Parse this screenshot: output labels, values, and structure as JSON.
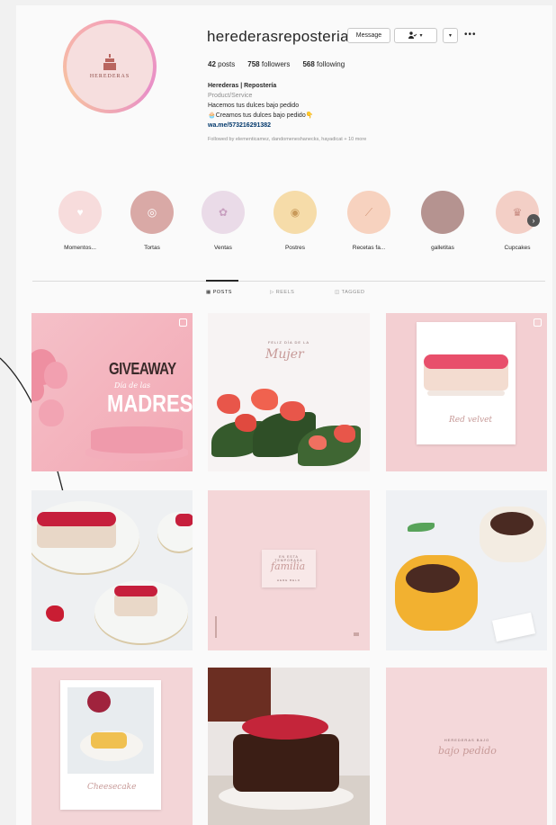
{
  "profile": {
    "username": "herederasreposteria",
    "logo_text": "HEREDERAS",
    "buttons": {
      "message": "Message",
      "follow_icon": "person-check-icon",
      "chevron": "chevron-down-icon",
      "more": "more-icon"
    },
    "stats": {
      "posts": "42",
      "posts_label": "posts",
      "followers": "758",
      "followers_label": "followers",
      "following": "568",
      "following_label": "following"
    },
    "bio": {
      "name": "Herederas | Repostería",
      "category": "Product/Service",
      "line1": "Hacemos tus dulces bajo pedido",
      "line2": "Creamos tus dulces bajo pedido",
      "link": "wa.me/573216291382",
      "followed_by": "Followed by elementicamez, dandomeneshanecks, hayadicat + 10 more"
    }
  },
  "highlights": [
    {
      "label": "Momentos...",
      "color": "#f7dcdc"
    },
    {
      "label": "Tortas",
      "color": "#d9a9a6"
    },
    {
      "label": "Ventas",
      "color": "#eadbe8"
    },
    {
      "label": "Postres",
      "color": "#f6dca9"
    },
    {
      "label": "Recetas fa...",
      "color": "#f7d2bf"
    },
    {
      "label": "galletitas",
      "color": "#b59390"
    },
    {
      "label": "Cupcakes",
      "color": "#f3cfc6"
    }
  ],
  "tabs": [
    {
      "label": "POSTS",
      "active": true
    },
    {
      "label": "REELS",
      "active": false
    },
    {
      "label": "TAGGED",
      "active": false
    }
  ],
  "posts": {
    "giveaway": {
      "title": "GIVEAWAY",
      "script": "Día de las",
      "big": "MADRES"
    },
    "mujer": {
      "small": "FELIZ DÍA DE LA",
      "script": "Mujer"
    },
    "drip": {
      "script": "Red velvet"
    },
    "familia": {
      "small": "EN ESTA TEMPORADA",
      "script": "familia",
      "tiny": "HERE BELO"
    },
    "passion": {
      "script": "Cheesecake"
    },
    "bajo": {
      "small": "HEREDERAS BAJO",
      "script": "bajo pedido"
    }
  }
}
